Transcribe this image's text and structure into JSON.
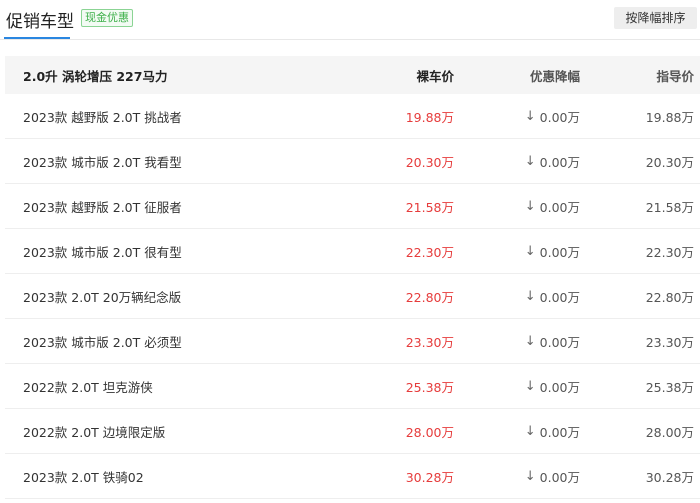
{
  "header": {
    "title": "促销车型",
    "badge": "现金优惠",
    "sort_button": "按降幅排序"
  },
  "table": {
    "columns": {
      "name": "2.0升 涡轮增压 227马力",
      "price": "裸车价",
      "discount": "优惠降幅",
      "guide": "指导价"
    },
    "rows": [
      {
        "name": "2023款 越野版 2.0T 挑战者",
        "price": "19.88万",
        "discount": "0.00万",
        "guide": "19.88万"
      },
      {
        "name": "2023款 城市版 2.0T 我看型",
        "price": "20.30万",
        "discount": "0.00万",
        "guide": "20.30万"
      },
      {
        "name": "2023款 越野版 2.0T 征服者",
        "price": "21.58万",
        "discount": "0.00万",
        "guide": "21.58万"
      },
      {
        "name": "2023款 城市版 2.0T 很有型",
        "price": "22.30万",
        "discount": "0.00万",
        "guide": "22.30万"
      },
      {
        "name": "2023款 2.0T 20万辆纪念版",
        "price": "22.80万",
        "discount": "0.00万",
        "guide": "22.80万"
      },
      {
        "name": "2023款 城市版 2.0T 必须型",
        "price": "23.30万",
        "discount": "0.00万",
        "guide": "23.30万"
      },
      {
        "name": "2022款 2.0T 坦克游侠",
        "price": "25.38万",
        "discount": "0.00万",
        "guide": "25.38万"
      },
      {
        "name": "2022款 2.0T 边境限定版",
        "price": "28.00万",
        "discount": "0.00万",
        "guide": "28.00万"
      },
      {
        "name": "2023款 2.0T 铁骑02",
        "price": "30.28万",
        "discount": "0.00万",
        "guide": "30.28万"
      }
    ],
    "down_arrow": "↓"
  },
  "colors": {
    "accent": "#2a86e0",
    "price_red": "#e63c3c",
    "badge_green": "#3eb04a"
  }
}
